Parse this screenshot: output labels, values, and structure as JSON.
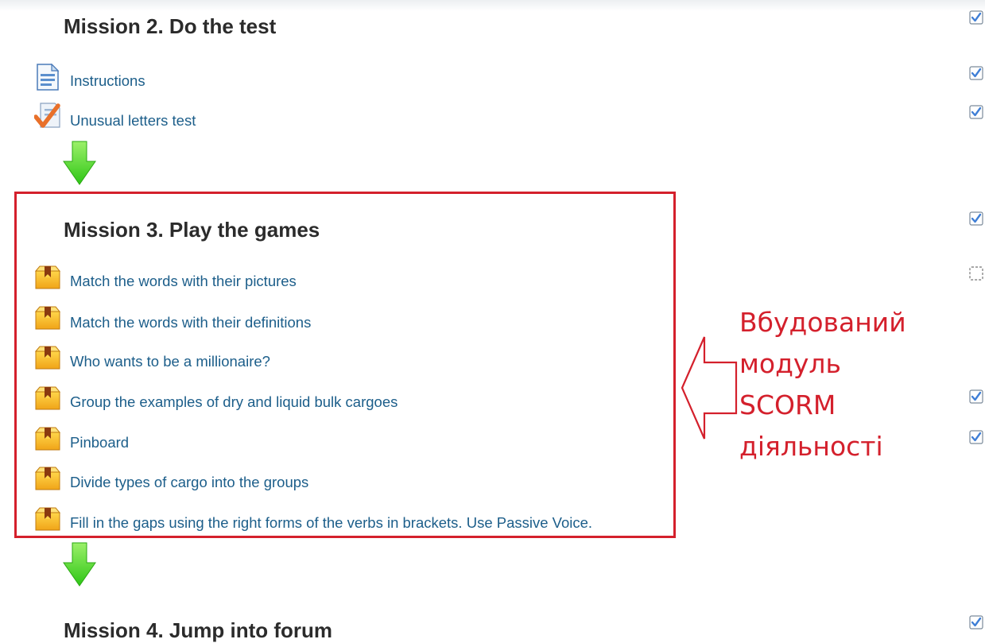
{
  "sections": [
    {
      "heading": "Mission 2. Do the test",
      "activities": [
        {
          "label": "Instructions",
          "icon": "page-icon"
        },
        {
          "label": "Unusual letters test",
          "icon": "quiz-check-icon"
        }
      ]
    },
    {
      "heading": "Mission 3. Play the games",
      "activities": [
        {
          "label": "Match the words with their pictures",
          "icon": "scorm-package-icon"
        },
        {
          "label": "Match the words with their definitions",
          "icon": "scorm-package-icon"
        },
        {
          "label": "Who wants to be a millionaire?",
          "icon": "scorm-package-icon"
        },
        {
          "label": "Group the examples of dry and liquid bulk cargoes",
          "icon": "scorm-package-icon"
        },
        {
          "label": "Pinboard",
          "icon": "scorm-package-icon"
        },
        {
          "label": "Divide types of cargo into the groups",
          "icon": "scorm-package-icon"
        },
        {
          "label": "Fill in the gaps using the right forms of the verbs in brackets. Use Passive Voice.",
          "icon": "scorm-package-icon"
        }
      ]
    },
    {
      "heading": "Mission 4. Jump into forum",
      "activities": []
    }
  ],
  "annotation": {
    "lines": [
      "Вбудований",
      "модуль",
      "SCORM",
      "діяльності"
    ]
  },
  "completion_marks": [
    {
      "state": "complete"
    },
    {
      "state": "complete"
    },
    {
      "state": "complete"
    },
    {
      "state": "complete"
    },
    {
      "state": "incomplete"
    },
    {
      "state": "complete"
    },
    {
      "state": "complete"
    },
    {
      "state": "complete"
    }
  ],
  "colors": {
    "link": "#1c5e8a",
    "heading": "#2b2b2b",
    "annotation": "#d4202c",
    "flow_arrow": "#44dd22",
    "checkbox": "#5a8dd6"
  }
}
